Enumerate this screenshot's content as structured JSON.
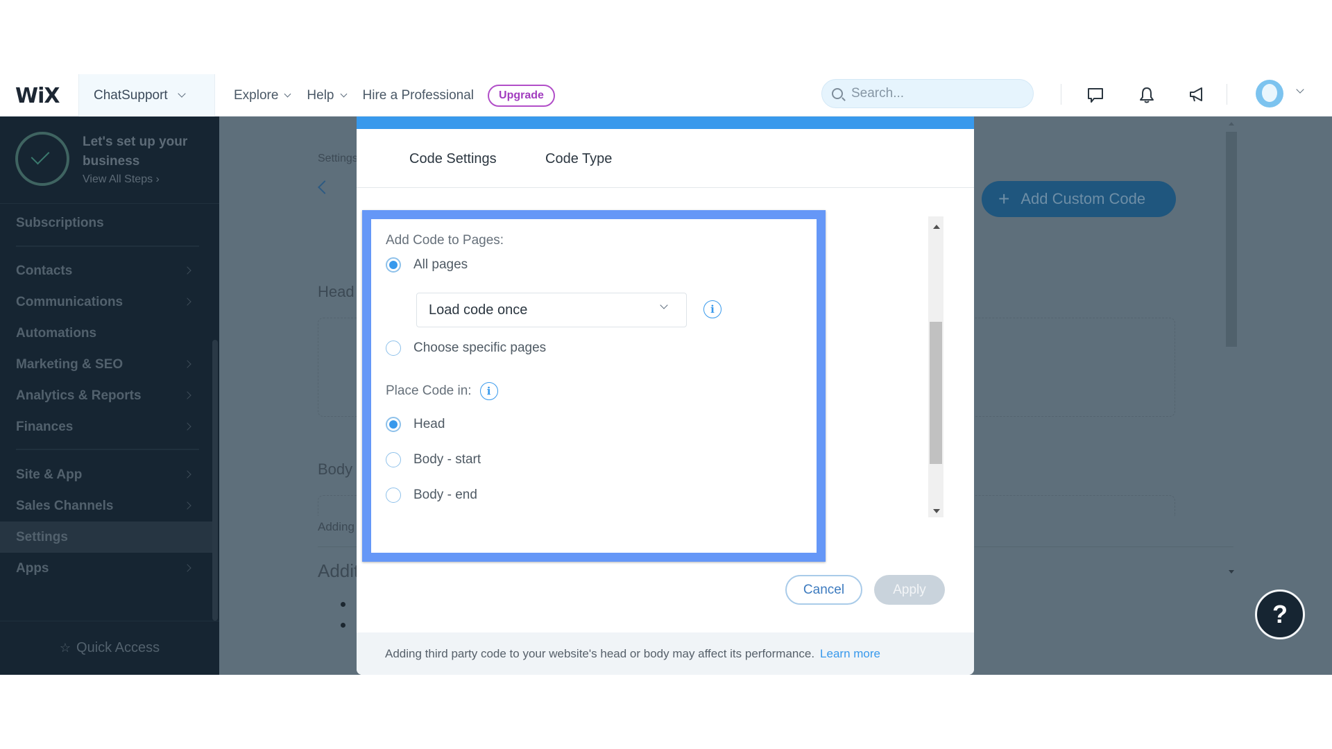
{
  "topbar": {
    "logo": "WiX",
    "site_name": "ChatSupport",
    "nav": [
      {
        "label": "Explore",
        "has_dropdown": true
      },
      {
        "label": "Help",
        "has_dropdown": true
      },
      {
        "label": "Hire a Professional",
        "has_dropdown": false
      }
    ],
    "upgrade_label": "Upgrade",
    "search_placeholder": "Search...",
    "icons": [
      "chat-icon",
      "bell-icon",
      "megaphone-icon"
    ],
    "colors": {
      "upgrade": "#a13cbf",
      "search_bg": "#e6f4fd"
    }
  },
  "sidebar": {
    "setup_title": "Let's set up your business",
    "setup_link": "View All Steps",
    "items": [
      {
        "label": "Subscriptions",
        "has_arrow": false
      },
      {
        "label": "Contacts",
        "has_arrow": true
      },
      {
        "label": "Communications",
        "has_arrow": true
      },
      {
        "label": "Automations",
        "has_arrow": false
      },
      {
        "label": "Marketing & SEO",
        "has_arrow": true
      },
      {
        "label": "Analytics & Reports",
        "has_arrow": true
      },
      {
        "label": "Finances",
        "has_arrow": true
      },
      {
        "label": "Site & App",
        "has_arrow": true
      },
      {
        "label": "Sales Channels",
        "has_arrow": true
      },
      {
        "label": "Settings",
        "has_arrow": false,
        "active": true
      },
      {
        "label": "Apps",
        "has_arrow": true
      }
    ],
    "quick_access": "Quick Access"
  },
  "background_page": {
    "breadcrumb": "Settings",
    "head_label": "Head",
    "body_label": "Body",
    "adding_text": "Adding",
    "additional_heading": "Additi",
    "add_custom_code": "Add Custom Code",
    "help_label": "?"
  },
  "modal": {
    "tabs": [
      {
        "label": "Code Settings",
        "active": true
      },
      {
        "label": "Code Type",
        "active": false
      }
    ],
    "add_code_label": "Add Code to Pages:",
    "pages_options": [
      {
        "label": "All pages",
        "checked": true
      },
      {
        "label": "Choose specific pages",
        "checked": false
      }
    ],
    "load_select_value": "Load code once",
    "place_code_label": "Place Code in:",
    "place_options": [
      {
        "label": "Head",
        "checked": true
      },
      {
        "label": "Body - start",
        "checked": false
      },
      {
        "label": "Body - end",
        "checked": false
      }
    ],
    "cancel_label": "Cancel",
    "apply_label": "Apply",
    "footer_text": "Adding third party code to your website's head or body may affect its performance.",
    "learn_more": "Learn more",
    "colors": {
      "accent": "#3899ec",
      "highlight_outline": "#6597f7"
    }
  }
}
